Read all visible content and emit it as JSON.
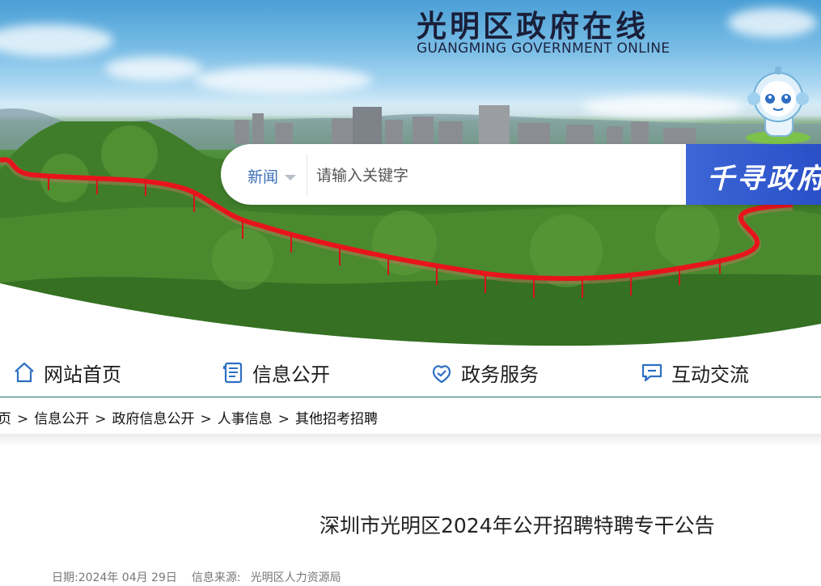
{
  "header": {
    "title": "光明区政府在线",
    "subtitle": "GUANGMING GOVERNMENT ONLINE"
  },
  "search": {
    "scope": "新闻",
    "placeholder": "请输入关键字",
    "button_label": "千寻政府"
  },
  "nav": {
    "items": [
      {
        "label": "网站首页",
        "icon": "home-icon"
      },
      {
        "label": "信息公开",
        "icon": "document-icon"
      },
      {
        "label": "政务服务",
        "icon": "handshake-icon"
      },
      {
        "label": "互动交流",
        "icon": "chat-icon"
      }
    ]
  },
  "breadcrumb": {
    "items": [
      "页",
      "信息公开",
      "政府信息公开",
      "人事信息",
      "其他招考招聘"
    ],
    "separator": ">"
  },
  "article": {
    "title": "深圳市光明区2024年公开招聘特聘专干公告",
    "date_label": "日期:",
    "date": "2024年 04月 29日",
    "source_label": "信息来源:",
    "source": "光明区人力资源局"
  },
  "colors": {
    "nav_border": "#1f6e6e",
    "search_scope": "#3b6fb6",
    "search_button": "#2f58cc",
    "bridge": "#e8141b",
    "icon_blue": "#2e6fc4"
  }
}
